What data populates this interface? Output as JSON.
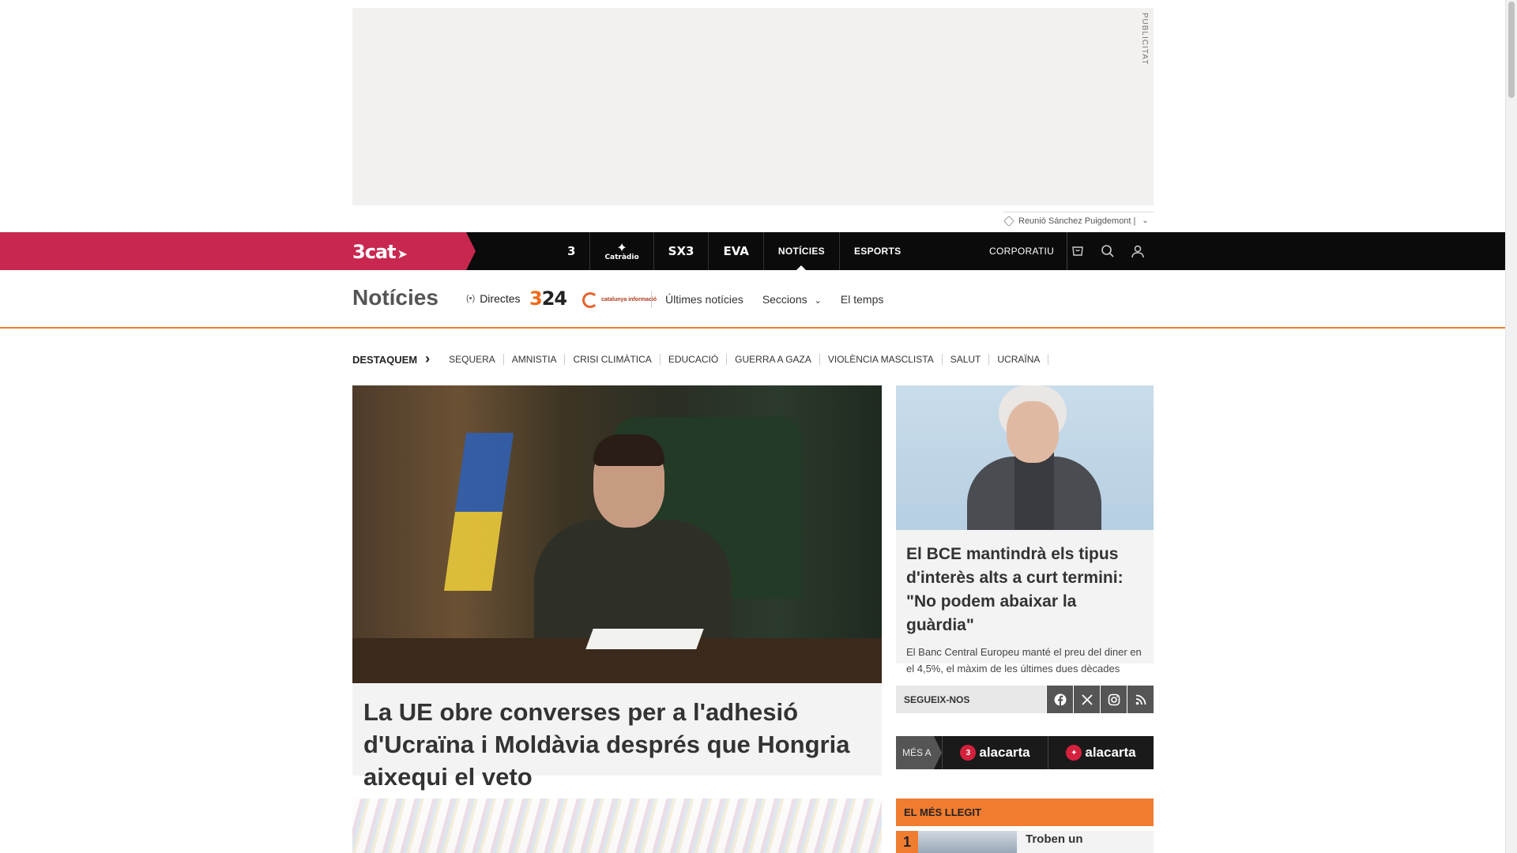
{
  "ad": {
    "label": "PUBLICITAT",
    "trend": "Reunió Sánchez Puigdemont |"
  },
  "topnav": {
    "brand": "3cat",
    "channels": [
      {
        "name": "tv3-logo",
        "label": "3"
      },
      {
        "name": "catradio-logo",
        "label": "Catràdio"
      },
      {
        "name": "sx3-logo",
        "label": "SX3"
      },
      {
        "name": "eva-logo",
        "label": "EVA"
      }
    ],
    "links": [
      "NOTÍCIES",
      "ESPORTS"
    ],
    "corporate": "CORPORATIU",
    "icons": [
      "cart-icon",
      "search-icon",
      "user-icon"
    ]
  },
  "section": {
    "title": "Notícies",
    "live": "Directes",
    "logo324": "324",
    "logo_catinfo": "catalunya informació",
    "nav": [
      "Últimes notícies",
      "Seccions",
      "El temps"
    ]
  },
  "destaquem": {
    "lead": "DESTAQUEM",
    "tags": [
      "SEQUERA",
      "AMNISTIA",
      "CRISI CLIMÀTICA",
      "EDUCACIÓ",
      "GUERRA A GAZA",
      "VIOLÈNCIA MASCLISTA",
      "SALUT",
      "UCRAÏNA"
    ]
  },
  "main_article": {
    "title": "La UE obre converses per a l'adhesió d'Ucraïna i Moldàvia després que Hongria aixequi el veto"
  },
  "side_article": {
    "title": "El BCE mantindrà els tipus d'interès alts a curt termini: \"No podem abaixar la guàrdia\"",
    "lede": "El Banc Central Europeu manté el preu del diner en el 4,5%, el màxim de les últimes dues dècades"
  },
  "follow": {
    "label": "SEGUEIX-NOS",
    "networks": [
      "facebook-icon",
      "x-icon",
      "instagram-icon",
      "rss-icon"
    ]
  },
  "mesa": {
    "label": "MÉS A",
    "items": [
      "alacarta",
      "alacarta"
    ]
  },
  "mostread": {
    "title": "EL MÉS LLEGIT",
    "items": [
      {
        "rank": "1",
        "title": "Troben un"
      }
    ]
  }
}
